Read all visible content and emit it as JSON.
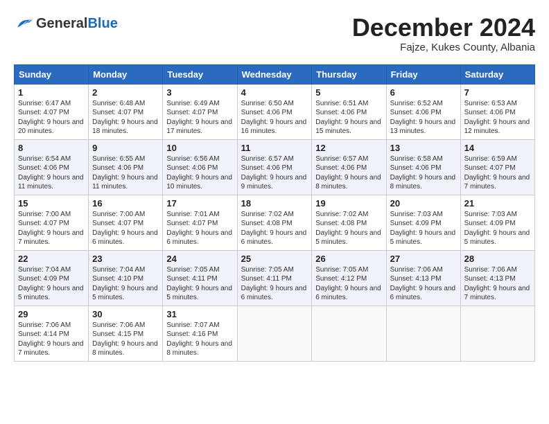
{
  "header": {
    "logo_general": "General",
    "logo_blue": "Blue",
    "month_title": "December 2024",
    "location": "Fajze, Kukes County, Albania"
  },
  "days_of_week": [
    "Sunday",
    "Monday",
    "Tuesday",
    "Wednesday",
    "Thursday",
    "Friday",
    "Saturday"
  ],
  "weeks": [
    [
      {
        "day": 1,
        "sunrise": "6:47 AM",
        "sunset": "4:07 PM",
        "daylight": "9 hours and 20 minutes."
      },
      {
        "day": 2,
        "sunrise": "6:48 AM",
        "sunset": "4:07 PM",
        "daylight": "9 hours and 18 minutes."
      },
      {
        "day": 3,
        "sunrise": "6:49 AM",
        "sunset": "4:07 PM",
        "daylight": "9 hours and 17 minutes."
      },
      {
        "day": 4,
        "sunrise": "6:50 AM",
        "sunset": "4:06 PM",
        "daylight": "9 hours and 16 minutes."
      },
      {
        "day": 5,
        "sunrise": "6:51 AM",
        "sunset": "4:06 PM",
        "daylight": "9 hours and 15 minutes."
      },
      {
        "day": 6,
        "sunrise": "6:52 AM",
        "sunset": "4:06 PM",
        "daylight": "9 hours and 13 minutes."
      },
      {
        "day": 7,
        "sunrise": "6:53 AM",
        "sunset": "4:06 PM",
        "daylight": "9 hours and 12 minutes."
      }
    ],
    [
      {
        "day": 8,
        "sunrise": "6:54 AM",
        "sunset": "4:06 PM",
        "daylight": "9 hours and 11 minutes."
      },
      {
        "day": 9,
        "sunrise": "6:55 AM",
        "sunset": "4:06 PM",
        "daylight": "9 hours and 11 minutes."
      },
      {
        "day": 10,
        "sunrise": "6:56 AM",
        "sunset": "4:06 PM",
        "daylight": "9 hours and 10 minutes."
      },
      {
        "day": 11,
        "sunrise": "6:57 AM",
        "sunset": "4:06 PM",
        "daylight": "9 hours and 9 minutes."
      },
      {
        "day": 12,
        "sunrise": "6:57 AM",
        "sunset": "4:06 PM",
        "daylight": "9 hours and 8 minutes."
      },
      {
        "day": 13,
        "sunrise": "6:58 AM",
        "sunset": "4:06 PM",
        "daylight": "9 hours and 8 minutes."
      },
      {
        "day": 14,
        "sunrise": "6:59 AM",
        "sunset": "4:07 PM",
        "daylight": "9 hours and 7 minutes."
      }
    ],
    [
      {
        "day": 15,
        "sunrise": "7:00 AM",
        "sunset": "4:07 PM",
        "daylight": "9 hours and 7 minutes."
      },
      {
        "day": 16,
        "sunrise": "7:00 AM",
        "sunset": "4:07 PM",
        "daylight": "9 hours and 6 minutes."
      },
      {
        "day": 17,
        "sunrise": "7:01 AM",
        "sunset": "4:07 PM",
        "daylight": "9 hours and 6 minutes."
      },
      {
        "day": 18,
        "sunrise": "7:02 AM",
        "sunset": "4:08 PM",
        "daylight": "9 hours and 6 minutes."
      },
      {
        "day": 19,
        "sunrise": "7:02 AM",
        "sunset": "4:08 PM",
        "daylight": "9 hours and 5 minutes."
      },
      {
        "day": 20,
        "sunrise": "7:03 AM",
        "sunset": "4:09 PM",
        "daylight": "9 hours and 5 minutes."
      },
      {
        "day": 21,
        "sunrise": "7:03 AM",
        "sunset": "4:09 PM",
        "daylight": "9 hours and 5 minutes."
      }
    ],
    [
      {
        "day": 22,
        "sunrise": "7:04 AM",
        "sunset": "4:09 PM",
        "daylight": "9 hours and 5 minutes."
      },
      {
        "day": 23,
        "sunrise": "7:04 AM",
        "sunset": "4:10 PM",
        "daylight": "9 hours and 5 minutes."
      },
      {
        "day": 24,
        "sunrise": "7:05 AM",
        "sunset": "4:11 PM",
        "daylight": "9 hours and 5 minutes."
      },
      {
        "day": 25,
        "sunrise": "7:05 AM",
        "sunset": "4:11 PM",
        "daylight": "9 hours and 6 minutes."
      },
      {
        "day": 26,
        "sunrise": "7:05 AM",
        "sunset": "4:12 PM",
        "daylight": "9 hours and 6 minutes."
      },
      {
        "day": 27,
        "sunrise": "7:06 AM",
        "sunset": "4:13 PM",
        "daylight": "9 hours and 6 minutes."
      },
      {
        "day": 28,
        "sunrise": "7:06 AM",
        "sunset": "4:13 PM",
        "daylight": "9 hours and 7 minutes."
      }
    ],
    [
      {
        "day": 29,
        "sunrise": "7:06 AM",
        "sunset": "4:14 PM",
        "daylight": "9 hours and 7 minutes."
      },
      {
        "day": 30,
        "sunrise": "7:06 AM",
        "sunset": "4:15 PM",
        "daylight": "9 hours and 8 minutes."
      },
      {
        "day": 31,
        "sunrise": "7:07 AM",
        "sunset": "4:16 PM",
        "daylight": "9 hours and 8 minutes."
      },
      null,
      null,
      null,
      null
    ]
  ]
}
